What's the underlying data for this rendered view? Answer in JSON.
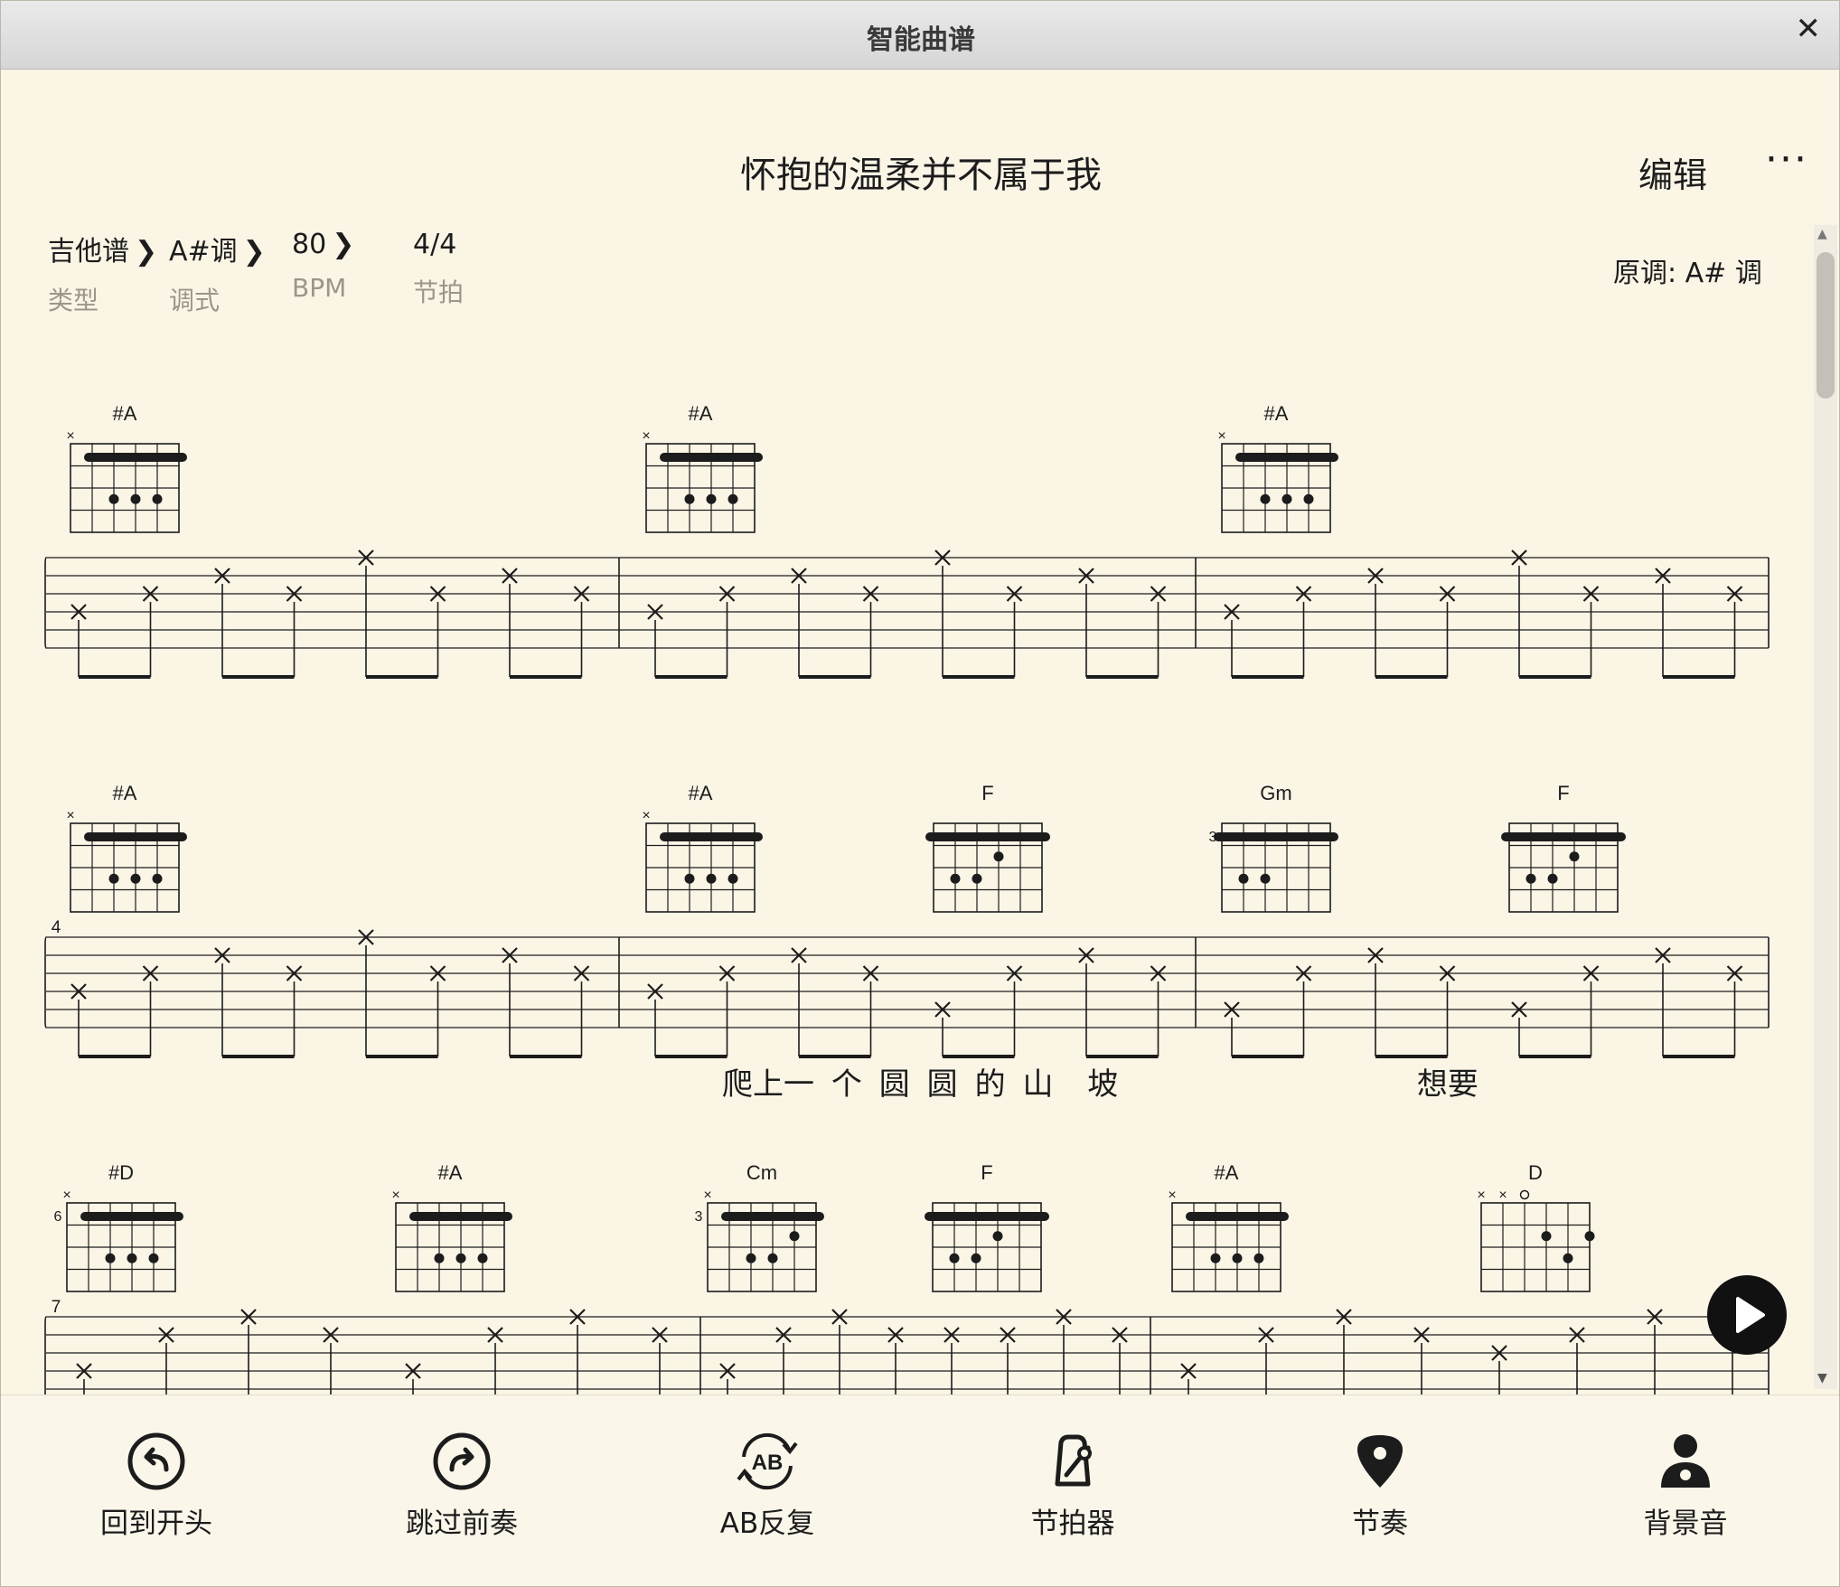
{
  "window": {
    "title": "智能曲谱",
    "close_label": "✕"
  },
  "song": {
    "title": "怀抱的温柔并不属于我",
    "edit_label": "编辑",
    "more_label": "···",
    "original_key": "原调:  A# 调"
  },
  "meta": [
    {
      "value": "吉他谱",
      "label": "类型",
      "arrow": true
    },
    {
      "value": "A#调",
      "label": "调式",
      "arrow": true
    },
    {
      "value": "80",
      "label": "BPM",
      "arrow": true
    },
    {
      "value": "4/4",
      "label": "节拍",
      "arrow": false
    }
  ],
  "systems": [
    {
      "measure_number": "",
      "chords": [
        "#A",
        "#A",
        "#A"
      ],
      "lyrics": ""
    },
    {
      "measure_number": "4",
      "chords": [
        "#A",
        "#A",
        "F",
        "Gm",
        "F"
      ],
      "lyrics": "爬上一  个  圆  圆  的  山    坡                                   想要"
    },
    {
      "measure_number": "7",
      "chords": [
        "#D",
        "#A",
        "Cm",
        "F",
        "#A",
        "D"
      ],
      "lyrics": ""
    }
  ],
  "chord_shapes": {
    "#A": {
      "barre": true,
      "muted": [
        6
      ],
      "open": [],
      "base_fret": "",
      "dots": [
        [
          4,
          3
        ],
        [
          3,
          3
        ],
        [
          2,
          3
        ]
      ]
    },
    "F": {
      "barre": true,
      "muted": [],
      "open": [],
      "base_fret": "",
      "dots": [
        [
          3,
          2
        ],
        [
          5,
          3
        ],
        [
          4,
          3
        ]
      ]
    },
    "Gm": {
      "barre": true,
      "muted": [],
      "open": [],
      "base_fret": "3",
      "dots": [
        [
          5,
          3
        ],
        [
          4,
          3
        ]
      ]
    },
    "#D": {
      "barre": true,
      "muted": [
        6
      ],
      "open": [],
      "base_fret": "6",
      "dots": [
        [
          4,
          3
        ],
        [
          3,
          3
        ],
        [
          2,
          3
        ]
      ]
    },
    "Cm": {
      "barre": true,
      "muted": [
        6
      ],
      "open": [],
      "base_fret": "3",
      "dots": [
        [
          2,
          2
        ],
        [
          4,
          3
        ],
        [
          3,
          3
        ]
      ]
    },
    "D": {
      "barre": false,
      "muted": [
        6,
        5
      ],
      "open": [
        4
      ],
      "base_fret": "",
      "dots": [
        [
          3,
          2
        ],
        [
          1,
          2
        ],
        [
          2,
          3
        ]
      ]
    }
  },
  "toolbar": [
    {
      "label": "回到开头",
      "icon": "rewind-start-icon"
    },
    {
      "label": "跳过前奏",
      "icon": "skip-intro-icon"
    },
    {
      "label": "AB反复",
      "icon": "ab-repeat-icon"
    },
    {
      "label": "节拍器",
      "icon": "metronome-icon"
    },
    {
      "label": "节奏",
      "icon": "guitar-pick-icon"
    },
    {
      "label": "背景音",
      "icon": "backing-person-icon"
    }
  ],
  "colors": {
    "paper": "#fbf5e6",
    "ink": "#1c1c1c",
    "muted_text": "#9b9689"
  }
}
